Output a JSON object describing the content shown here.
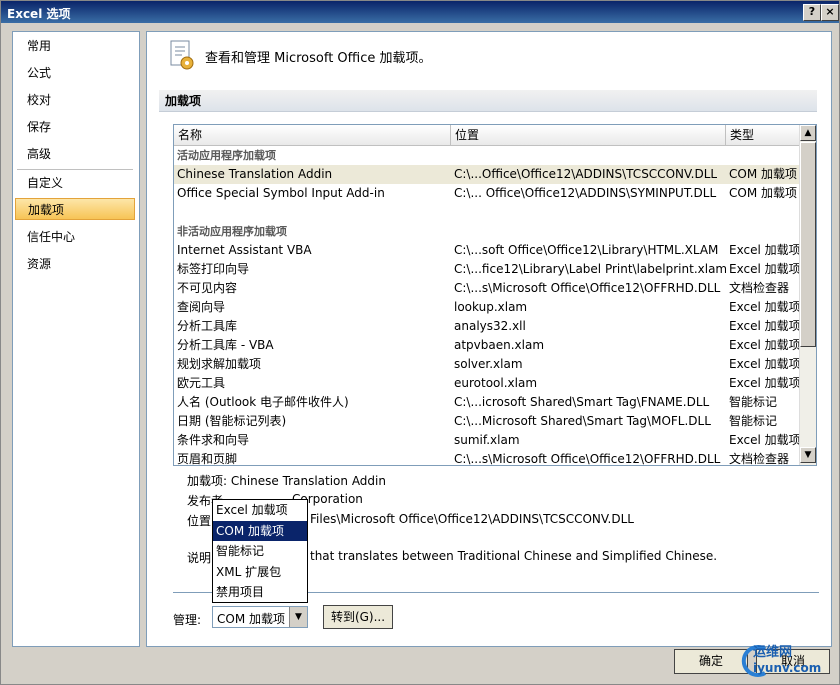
{
  "window": {
    "title": "Excel 选项",
    "help": "?",
    "close": "×"
  },
  "nav": {
    "items": [
      "常用",
      "公式",
      "校对",
      "保存",
      "高级",
      "自定义",
      "加载项",
      "信任中心",
      "资源"
    ],
    "selected": "加载项"
  },
  "header": {
    "text": "查看和管理 Microsoft Office 加载项。"
  },
  "section": {
    "title": "加载项"
  },
  "list": {
    "columns": [
      "名称",
      "位置",
      "类型"
    ],
    "groups": [
      {
        "title": "活动应用程序加载项",
        "rows": [
          {
            "name": "Chinese Translation Addin",
            "location": "C:\\...Office\\Office12\\ADDINS\\TCSCCONV.DLL",
            "type": "COM 加载项"
          },
          {
            "name": "Office Special Symbol Input Add-in",
            "location": "C:\\... Office\\Office12\\ADDINS\\SYMINPUT.DLL",
            "type": "COM 加载项"
          }
        ]
      },
      {
        "title": "非活动应用程序加载项",
        "rows": [
          {
            "name": "Internet Assistant VBA",
            "location": "C:\\...soft Office\\Office12\\Library\\HTML.XLAM",
            "type": "Excel 加载项"
          },
          {
            "name": "标签打印向导",
            "location": "C:\\...fice12\\Library\\Label Print\\labelprint.xlam",
            "type": "Excel 加载项"
          },
          {
            "name": "不可见内容",
            "location": "C:\\...s\\Microsoft Office\\Office12\\OFFRHD.DLL",
            "type": "文档检查器"
          },
          {
            "name": "查阅向导",
            "location": "lookup.xlam",
            "type": "Excel 加载项"
          },
          {
            "name": "分析工具库",
            "location": "analys32.xll",
            "type": "Excel 加载项"
          },
          {
            "name": "分析工具库 - VBA",
            "location": "atpvbaen.xlam",
            "type": "Excel 加载项"
          },
          {
            "name": "规划求解加载项",
            "location": "solver.xlam",
            "type": "Excel 加载项"
          },
          {
            "name": "欧元工具",
            "location": "eurotool.xlam",
            "type": "Excel 加载项"
          },
          {
            "name": "人名 (Outlook 电子邮件收件人)",
            "location": "C:\\...icrosoft Shared\\Smart Tag\\FNAME.DLL",
            "type": "智能标记"
          },
          {
            "name": "日期 (智能标记列表)",
            "location": "C:\\...Microsoft Shared\\Smart Tag\\MOFL.DLL",
            "type": "智能标记"
          },
          {
            "name": "条件求和向导",
            "location": "sumif.xlam",
            "type": "Excel 加载项"
          },
          {
            "name": "页眉和页脚",
            "location": "C:\\...s\\Microsoft Office\\Office12\\OFFRHD.DLL",
            "type": "文档检查器"
          }
        ]
      }
    ]
  },
  "details": {
    "addin": "加载项:  Chinese Translation Addin",
    "publisher_label": "发布者",
    "publisher_tail": "Corporation",
    "location_label": "位置",
    "location_tail": "Files\\Microsoft Office\\Office12\\ADDINS\\TCSCCONV.DLL",
    "desc_label": "说明",
    "desc_tail": "that translates between Traditional Chinese and Simplified Chinese."
  },
  "manage": {
    "label": "管理:",
    "value": "COM 加载项",
    "goto": "转到(G)...",
    "options": [
      "Excel 加载项",
      "COM 加载项",
      "智能标记",
      "XML 扩展包",
      "禁用项目"
    ],
    "selected_option": "COM 加载项"
  },
  "buttons": {
    "ok": "确定",
    "cancel": "取消"
  },
  "watermark": {
    "text1": "运维网",
    "text2": "iyunv.com"
  }
}
